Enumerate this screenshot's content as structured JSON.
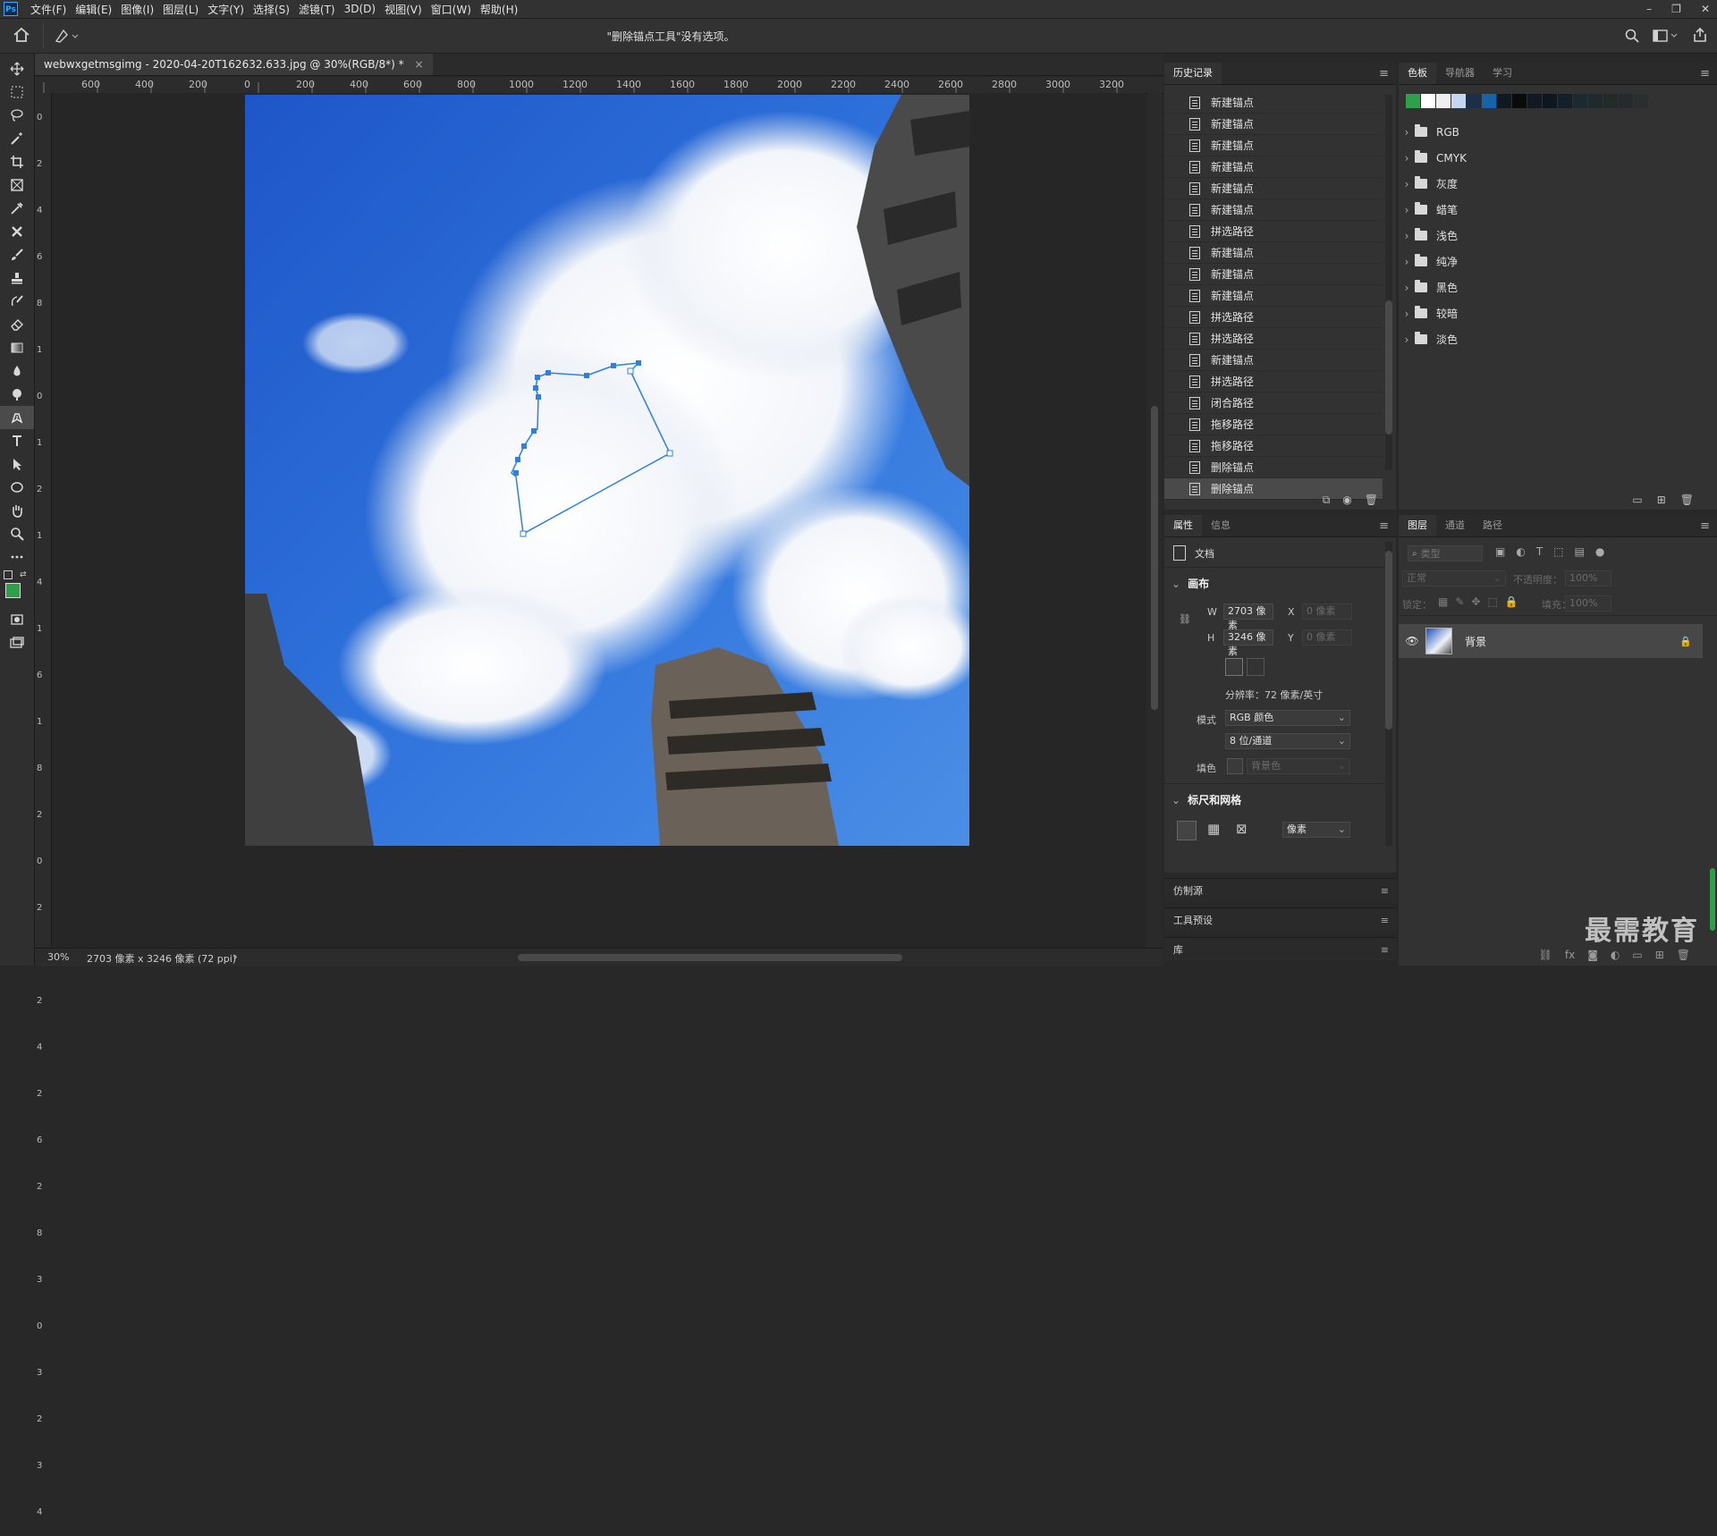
{
  "app": {
    "logo_text": "Ps",
    "menu": [
      "文件(F)",
      "编辑(E)",
      "图像(I)",
      "图层(L)",
      "文字(Y)",
      "选择(S)",
      "滤镜(T)",
      "3D(D)",
      "视图(V)",
      "窗口(W)",
      "帮助(H)"
    ],
    "window_controls": [
      "–",
      "❐",
      "✕"
    ]
  },
  "options_bar": {
    "title": "\"删除锚点工具\"没有选项。"
  },
  "document": {
    "tab_label": "webwxgetmsgimg - 2020-04-20T162632.633.jpg @ 30%(RGB/8*) *",
    "tab_close": "×",
    "ruler_ticks": [
      "600",
      "400",
      "200",
      "0",
      "200",
      "400",
      "600",
      "800",
      "1000",
      "1200",
      "1400",
      "1600",
      "1800",
      "2000",
      "2200",
      "2400",
      "2600",
      "2800",
      "3000",
      "3200"
    ],
    "vruler_ticks": [
      "0",
      "2",
      "4",
      "6",
      "8",
      "1 0",
      "1 2",
      "1 4",
      "1 6",
      "1 8",
      "2 0",
      "2 2",
      "2 4",
      "2 6",
      "2 8",
      "3 0",
      "3 2",
      "3 4"
    ]
  },
  "status_bar": {
    "zoom": "30%",
    "info": "2703 像素 x 3246 像素 (72 ppi)",
    "arrow": "›"
  },
  "history": {
    "tab_label": "历史记录",
    "items": [
      "新建锚点",
      "新建锚点",
      "新建锚点",
      "新建锚点",
      "新建锚点",
      "新建锚点",
      "拼选路径",
      "新建锚点",
      "新建锚点",
      "新建锚点",
      "拼选路径",
      "拼选路径",
      "新建锚点",
      "拼选路径",
      "闭合路径",
      "拖移路径",
      "拖移路径",
      "删除锚点",
      "删除锚点"
    ],
    "selected_index": 18
  },
  "swatches": {
    "tabs": [
      "色板",
      "导航器",
      "学习"
    ],
    "colors": [
      "#2ea04a",
      "#ffffff",
      "#eeeeee",
      "#c4d6f2",
      "#1c2f48",
      "#1763a8",
      "#101820",
      "#0a0a0a",
      "#121922",
      "#0e1720",
      "#132029",
      "#1a2a30",
      "#1e2a2c",
      "#222a2a",
      "#262a2a",
      "#2a2e2e"
    ],
    "groups": [
      "RGB",
      "CMYK",
      "灰度",
      "蜡笔",
      "浅色",
      "纯净",
      "黑色",
      "较暗",
      "淡色"
    ]
  },
  "properties": {
    "tabs": [
      "属性",
      "信息"
    ],
    "doc_label": "文档",
    "canvas_section": "画布",
    "w_label": "W",
    "w_value": "2703 像素",
    "h_label": "H",
    "h_value": "3246 像素",
    "x_label": "X",
    "x_value": "0 像素",
    "y_label": "Y",
    "y_value": "0 像素",
    "resolution": "分辨率：72 像素/英寸",
    "mode_label": "模式",
    "mode_value": "RGB 颜色",
    "depth_value": "8 位/通道",
    "fill_label": "填色",
    "fill_value": "背景色",
    "rulers_section": "标尺和网格",
    "unit_value": "像素"
  },
  "collapsed_panels": [
    "仿制源",
    "工具预设",
    "库"
  ],
  "layers": {
    "tabs": [
      "图层",
      "通道",
      "路径"
    ],
    "search_placeholder": "类型",
    "blend_mode": "正常",
    "opacity_label": "不透明度：",
    "opacity_value": "100%",
    "lock_label": "锁定：",
    "fill_label": "填充：",
    "fill_value": "100%",
    "layer_name": "背景"
  },
  "watermark": "最需教育"
}
